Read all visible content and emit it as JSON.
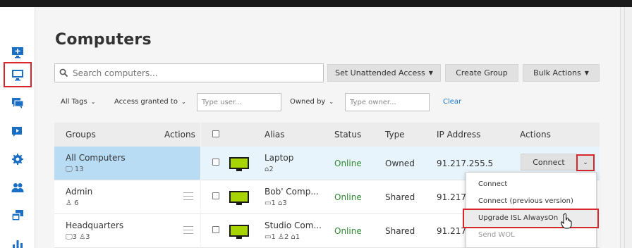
{
  "page": {
    "title": "Computers"
  },
  "nav": {
    "items": [
      {
        "name": "add-computer",
        "icon": "monitor-plus-icon"
      },
      {
        "name": "computers",
        "icon": "monitor-icon",
        "active": true
      },
      {
        "name": "chat",
        "icon": "chat-icon"
      },
      {
        "name": "video",
        "icon": "video-icon"
      },
      {
        "name": "settings",
        "icon": "gear-icon"
      },
      {
        "name": "users",
        "icon": "users-icon"
      },
      {
        "name": "windows",
        "icon": "windows-icon"
      },
      {
        "name": "stats",
        "icon": "bar-chart-icon"
      }
    ]
  },
  "search": {
    "placeholder": "Search computers..."
  },
  "toolbar": {
    "unattended": "Set Unattended Access",
    "create_group": "Create Group",
    "bulk_actions": "Bulk Actions"
  },
  "filters": {
    "all_tags": "All Tags",
    "access_granted": "Access granted to",
    "type_user_placeholder": "Type user...",
    "owned_by": "Owned by",
    "type_owner_placeholder": "Type owner...",
    "clear": "Clear"
  },
  "groups_panel": {
    "header_groups": "Groups",
    "header_actions": "Actions",
    "groups": [
      {
        "name": "All Computers",
        "meta": "13",
        "selected": true
      },
      {
        "name": "Admin",
        "meta": "6"
      },
      {
        "name": "Headquarters",
        "meta_computers": "3",
        "meta_users": "3"
      }
    ]
  },
  "table": {
    "headers": {
      "alias": "Alias",
      "status": "Status",
      "type": "Type",
      "ip": "IP Address",
      "actions": "Actions"
    },
    "rows": [
      {
        "alias": "Laptop",
        "tags": "2",
        "status": "Online",
        "type": "Owned",
        "ip": "91.217.255.5",
        "connect": "Connect"
      },
      {
        "alias": "Bob' Comp...",
        "groups": "1",
        "tags": "3",
        "status": "Online",
        "type": "Shared",
        "ip": "91.217."
      },
      {
        "alias": "Studio Com...",
        "groups": "1",
        "users": "2",
        "tags": "1",
        "status": "Online",
        "type": "Shared",
        "ip": "91.217."
      }
    ]
  },
  "dropdown": {
    "items": [
      "Connect",
      "Connect (previous version)",
      "Upgrade ISL AlwaysOn",
      "Send WOL"
    ]
  },
  "colors": {
    "accent_red": "#d9262c",
    "nav_blue": "#1a6fc4",
    "monitor_green": "#a8d400",
    "online_green": "#2e8b2e",
    "selected_blue": "#b9dcf5"
  }
}
